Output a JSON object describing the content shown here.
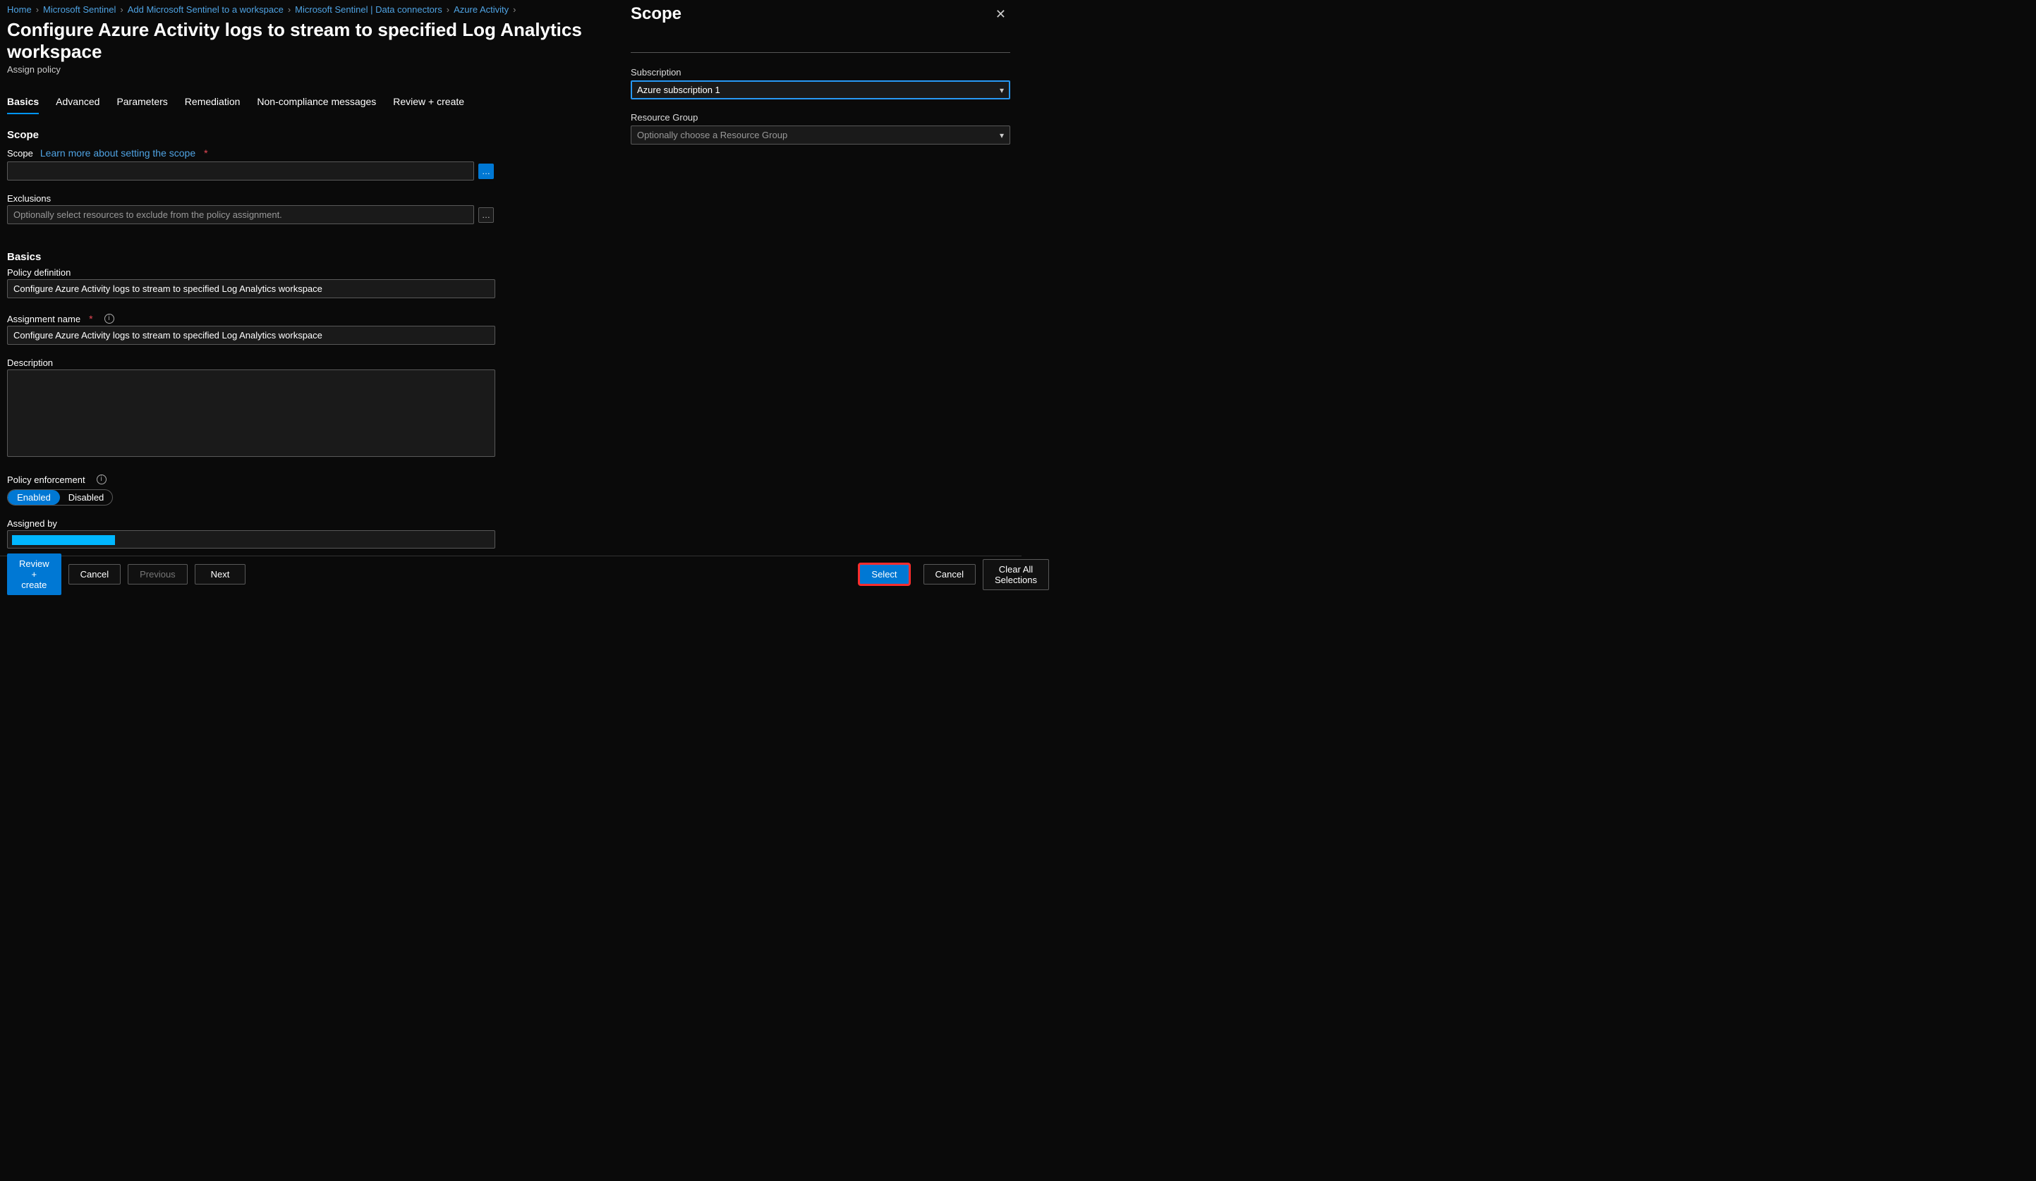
{
  "breadcrumb": [
    {
      "label": "Home"
    },
    {
      "label": "Microsoft Sentinel"
    },
    {
      "label": "Add Microsoft Sentinel to a workspace"
    },
    {
      "label": "Microsoft Sentinel | Data connectors"
    },
    {
      "label": "Azure Activity"
    }
  ],
  "page": {
    "title": "Configure Azure Activity logs to stream to specified Log Analytics workspace",
    "subtitle": "Assign policy"
  },
  "tabs": [
    {
      "label": "Basics",
      "active": true
    },
    {
      "label": "Advanced"
    },
    {
      "label": "Parameters"
    },
    {
      "label": "Remediation"
    },
    {
      "label": "Non-compliance messages"
    },
    {
      "label": "Review + create"
    }
  ],
  "scope_section": {
    "heading": "Scope",
    "scope_label": "Scope",
    "learn_more": "Learn more about setting the scope",
    "scope_value": "",
    "exclusions_label": "Exclusions",
    "exclusions_placeholder": "Optionally select resources to exclude from the policy assignment."
  },
  "basics_section": {
    "heading": "Basics",
    "policy_def_label": "Policy definition",
    "policy_def_value": "Configure Azure Activity logs to stream to specified Log Analytics workspace",
    "assign_name_label": "Assignment name",
    "assign_name_value": "Configure Azure Activity logs to stream to specified Log Analytics workspace",
    "description_label": "Description",
    "description_value": "",
    "enforcement_label": "Policy enforcement",
    "enforcement_options": [
      "Enabled",
      "Disabled"
    ],
    "enforcement_active": "Enabled",
    "assigned_by_label": "Assigned by"
  },
  "footer": {
    "review": "Review + create",
    "cancel": "Cancel",
    "previous": "Previous",
    "next": "Next",
    "select": "Select",
    "panel_cancel": "Cancel",
    "clear_all": "Clear All Selections"
  },
  "side_panel": {
    "title": "Scope",
    "subscription_label": "Subscription",
    "subscription_value": "Azure subscription 1",
    "rg_label": "Resource Group",
    "rg_placeholder": "Optionally choose a Resource Group"
  }
}
